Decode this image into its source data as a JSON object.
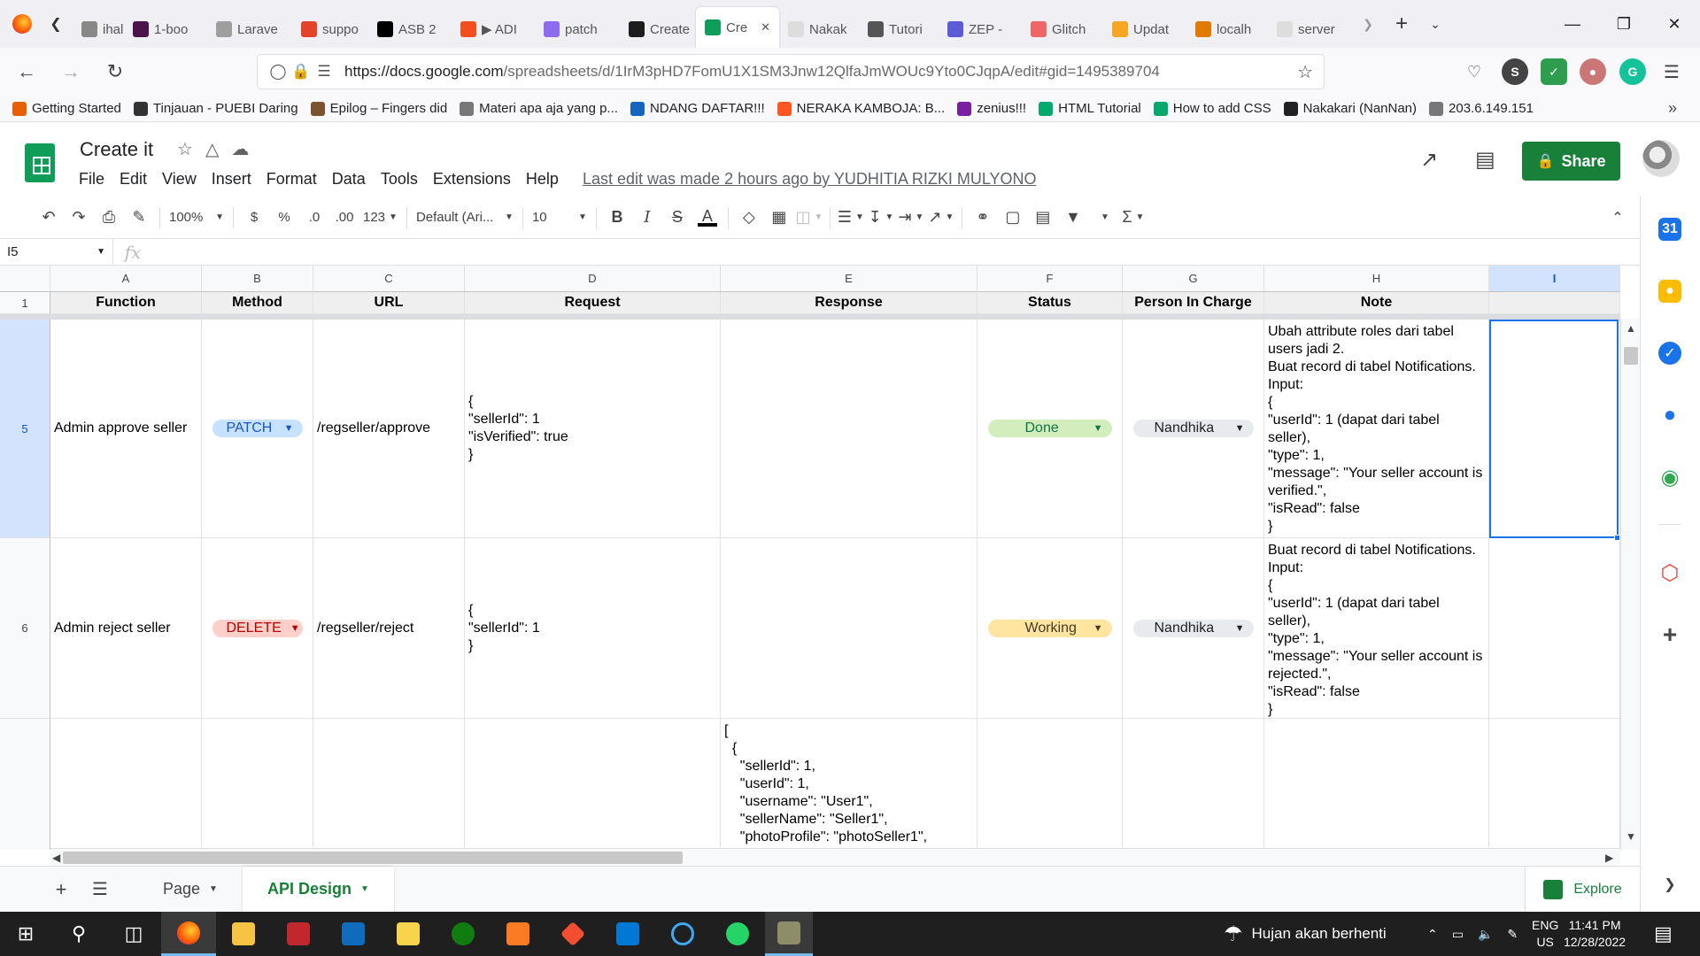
{
  "browser": {
    "tabs": [
      {
        "label": "ihal",
        "color": "#888888"
      },
      {
        "label": "1-boo",
        "color": "#4a154b"
      },
      {
        "label": "Larave",
        "color": "#9e9e9e"
      },
      {
        "label": "suppo",
        "color": "#e24329"
      },
      {
        "label": "ASB 2",
        "color": "#000000"
      },
      {
        "label": "▶ ADI",
        "color": "#f24e1e"
      },
      {
        "label": "patch",
        "color": "#8c6df0"
      },
      {
        "label": "Create",
        "color": "#1d1d1d"
      },
      {
        "label": "Cre",
        "color": "#0f9d58",
        "active": true
      },
      {
        "label": "Nakak",
        "color": "#dddddd"
      },
      {
        "label": "Tutori",
        "color": "#555555"
      },
      {
        "label": "ZEP -",
        "color": "#5b5bd6"
      },
      {
        "label": "Glitch",
        "color": "#e66"
      },
      {
        "label": "Updat",
        "color": "#f5a623"
      },
      {
        "label": "localh",
        "color": "#e07b00"
      },
      {
        "label": "server",
        "color": "#dddddd"
      }
    ],
    "url_host": "https://docs.google.com",
    "url_path": "/spreadsheets/d/1IrM3pHD7FomU1X1SM3Jnw12QlfaJmWOUc9Yto0CJqpA/edit#gid=1495389704",
    "bookmarks": [
      {
        "label": "Getting Started",
        "color": "#e66000"
      },
      {
        "label": "Tinjauan - PUEBI Daring",
        "color": "#333333"
      },
      {
        "label": "Epilog – Fingers did",
        "color": "#7a5230"
      },
      {
        "label": "Materi apa aja yang p...",
        "color": "#777777"
      },
      {
        "label": "NDANG DAFTAR!!!",
        "color": "#1565c0"
      },
      {
        "label": "NERAKA KAMBOJA: B...",
        "color": "#ff5722"
      },
      {
        "label": "zenius!!!",
        "color": "#7b1fa2"
      },
      {
        "label": "HTML Tutorial",
        "color": "#04aa6d"
      },
      {
        "label": "How to add CSS",
        "color": "#04aa6d"
      },
      {
        "label": "Nakakari (NanNan)",
        "color": "#222222"
      },
      {
        "label": "203.6.149.151",
        "color": "#777777"
      }
    ]
  },
  "sheets": {
    "title": "Create it",
    "menu": [
      "File",
      "Edit",
      "View",
      "Insert",
      "Format",
      "Data",
      "Tools",
      "Extensions",
      "Help"
    ],
    "last_edit": "Last edit was made 2 hours ago by YUDHITIA RIZKI MULYONO",
    "share_label": "Share",
    "toolbar": {
      "zoom": "100%",
      "currency": "$",
      "percent": "%",
      "dec_decrease": ".0",
      "dec_increase": ".00",
      "more_formats": "123",
      "font": "Default (Ari...",
      "font_size": "10"
    },
    "name_box": "I5",
    "fx": "fx"
  },
  "grid": {
    "columns": [
      "A",
      "B",
      "C",
      "D",
      "E",
      "F",
      "G",
      "H",
      "I"
    ],
    "header_row_num": "1",
    "headers": [
      "Function",
      "Method",
      "URL",
      "Request",
      "Response",
      "Status",
      "Person In Charge",
      "Note"
    ],
    "rows": [
      {
        "num": "5",
        "function": "Admin approve seller",
        "method": "PATCH",
        "method_bg": "#c6e2ff",
        "method_fg": "#1a56c4",
        "url": "/regseller/approve",
        "request": "{\n\"sellerId\": 1\n\"isVerified\": true\n}",
        "response": "",
        "status": "Done",
        "status_bg": "#d4edbc",
        "status_fg": "#11734b",
        "pic": "Nandhika",
        "note": "Ubah attribute roles dari tabel users jadi 2.\nBuat record di tabel Notifications.\nInput:\n{\n\"userId\": 1 (dapat dari tabel seller),\n\"type\": 1,\n\"message\": \"Your seller account is verified.\",\n\"isRead\": false\n}"
      },
      {
        "num": "6",
        "function": "Admin reject seller",
        "method": "DELETE",
        "method_bg": "#ffcfc9",
        "method_fg": "#b10202",
        "url": "/regseller/reject",
        "request": "{\n\"sellerId\": 1\n}",
        "response": "",
        "status": "Working",
        "status_bg": "#ffe5a0",
        "status_fg": "#473821",
        "pic": "Nandhika",
        "note": "Buat record di tabel Notifications.\nInput:\n{\n\"userId\": 1 (dapat dari tabel seller),\n\"type\": 1,\n\"message\": \"Your seller account is rejected.\",\n\"isRead\": false\n}"
      },
      {
        "num": "",
        "function": "",
        "url": "",
        "request": "",
        "response": "[\n  {\n    \"sellerId\": 1,\n    \"userId\": 1,\n    \"username\": \"User1\",\n    \"sellerName\": \"Seller1\",\n    \"photoProfile\": \"photoSeller1\",",
        "note": ""
      }
    ],
    "pic_chip_bg": "#e8eaed"
  },
  "sheet_tabs": [
    {
      "label": "Page",
      "active": false
    },
    {
      "label": "API Design",
      "active": true
    }
  ],
  "explore_label": "Explore",
  "taskbar": {
    "weather": "Hujan akan berhenti",
    "lang_1": "ENG",
    "lang_2": "US",
    "time": "11:41 PM",
    "date": "12/28/2022"
  }
}
